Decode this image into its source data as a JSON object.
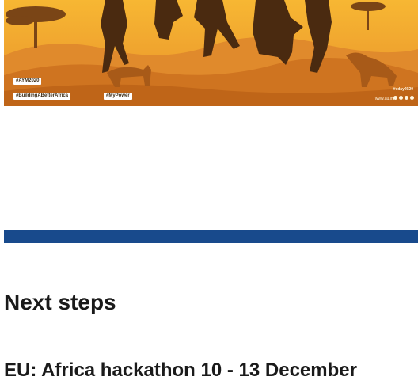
{
  "banner": {
    "hashtags": [
      "#AYM2020",
      "#BuildingABetterAfrica",
      "#MyPower"
    ],
    "handle": "#eday2020",
    "site": "www.au.int"
  },
  "colors": {
    "banner_sky": "#f3a52a",
    "banner_ground": "#c9741c",
    "silhouette": "#4a2a10",
    "divider_bar": "#184a8c",
    "text": "#1a1a1a"
  },
  "content": {
    "section_title": "Next steps",
    "article_title": "EU: Africa hackathon 10 - 13 December"
  }
}
